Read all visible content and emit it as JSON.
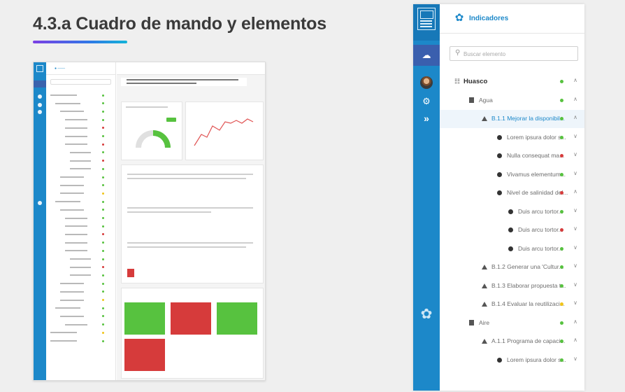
{
  "slide": {
    "title": "4.3.a Cuadro de mando y elementos"
  },
  "colors": {
    "primary": "#1c88c9",
    "rail_active": "#3a5fae",
    "green": "#57c23f",
    "red": "#d63b3b",
    "yellow": "#f0c419"
  },
  "panel": {
    "app_name": "Indicadores",
    "logo_icon": "tree-icon",
    "search": {
      "placeholder": "Buscar elemento",
      "value": ""
    },
    "rail": [
      "home-book-icon",
      "cloud-icon",
      "user-avatar",
      "settings-icon",
      "double-chevron-icon",
      "tree-icon"
    ],
    "tree": [
      {
        "label": "Huasco",
        "level": 0,
        "icon": "org-icon",
        "status": "green",
        "chevron": "up",
        "bold": true
      },
      {
        "label": "Agua",
        "level": 1,
        "icon": "square",
        "status": "green",
        "chevron": "up"
      },
      {
        "label": "B.1.1 Mejorar la disponibil...",
        "level": 2,
        "icon": "tri",
        "status": "green",
        "chevron": "up",
        "selected": true
      },
      {
        "label": "Lorem ipsura dolor s...",
        "level": 3,
        "icon": "bullet",
        "status": "green",
        "chevron": "down"
      },
      {
        "label": "Nulla consequat ma...",
        "level": 3,
        "icon": "bullet",
        "status": "red",
        "chevron": "down"
      },
      {
        "label": "Vivamus elementum...",
        "level": 3,
        "icon": "bullet",
        "status": "green",
        "chevron": "down"
      },
      {
        "label": "Nivel de salinidad del...",
        "level": 3,
        "icon": "bullet",
        "status": "red",
        "chevron": "up"
      },
      {
        "label": "Duis arcu tortor...",
        "level": 4,
        "icon": "bullet",
        "status": "green",
        "chevron": "down"
      },
      {
        "label": "Duis arcu tortor...",
        "level": 4,
        "icon": "bullet",
        "status": "red",
        "chevron": "down"
      },
      {
        "label": "Duis arcu tortor...",
        "level": 4,
        "icon": "bullet",
        "status": "green",
        "chevron": "down"
      },
      {
        "label": "B.1.2 Generar una 'Cultur...",
        "level": 2,
        "icon": "tri",
        "status": "green",
        "chevron": "down"
      },
      {
        "label": "B.1.3 Elaborar propuesta t...",
        "level": 2,
        "icon": "tri",
        "status": "green",
        "chevron": "down"
      },
      {
        "label": "B.1.4 Evaluar la reutilizaci...",
        "level": 2,
        "icon": "tri",
        "status": "yellow",
        "chevron": "down"
      },
      {
        "label": "Aire",
        "level": 1,
        "icon": "square",
        "status": "green",
        "chevron": "up"
      },
      {
        "label": "A.1.1 Programa de capaci...",
        "level": 2,
        "icon": "tri",
        "status": "green",
        "chevron": "up"
      },
      {
        "label": "Lorem ipsura dolor s...",
        "level": 3,
        "icon": "bullet",
        "status": "green",
        "chevron": "down"
      }
    ]
  }
}
